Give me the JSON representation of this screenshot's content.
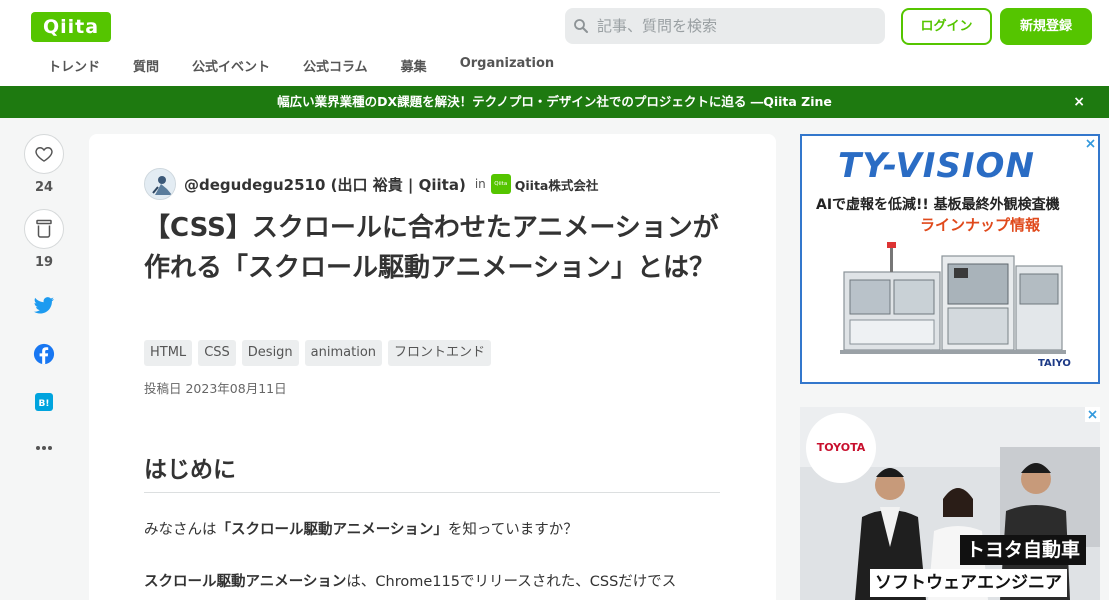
{
  "header": {
    "logo_text": "Qiita",
    "search_placeholder": "記事、質問を検索",
    "login_label": "ログイン",
    "signup_label": "新規登録",
    "nav": [
      "トレンド",
      "質問",
      "公式イベント",
      "公式コラム",
      "募集",
      "Organization"
    ]
  },
  "banner": {
    "text": "幅広い業界業種のDX課題を解決！テクノプロ・デザイン社でのプロジェクトに迫る ―Qiita Zine",
    "close_glyph": "×"
  },
  "actions": {
    "likes_count": "24",
    "stock_count": "19"
  },
  "article": {
    "author": "@degudegu2510 (出口 裕貴 | Qiita)",
    "in_label": "in",
    "org_logo_text": "Qiita",
    "organization": "Qiita株式会社",
    "title": "【CSS】スクロールに合わせたアニメーションが作れる「スクロール駆動アニメーション」とは？",
    "tags": [
      "HTML",
      "CSS",
      "Design",
      "animation",
      "フロントエンド"
    ],
    "posted_date": "投稿日 2023年08月11日",
    "heading": "はじめに",
    "para1_pre": "みなさんは",
    "para1_bold": "「スクロール駆動アニメーション」",
    "para1_post": "を知っていますか？",
    "para2_bold": "スクロール駆動アニメーション",
    "para2_post": "は、Chrome115でリリースされた、CSSだけでス"
  },
  "ads": {
    "ad1": {
      "brand": "TY-VISION",
      "tagline1": "AIで虚報を低減!! 基板最終外観検査機",
      "tagline2": "ラインナップ情報",
      "maker": "TAIYO"
    },
    "ad2": {
      "logo_text": "TOYOTA",
      "caption1": "トヨタ自動車",
      "caption2": "ソフトウェアエンジニア"
    }
  },
  "colors": {
    "brand_green": "#55c500",
    "banner_green": "#1e7a10",
    "twitter_blue": "#1d9bf0",
    "facebook_blue": "#1877f2",
    "hatena_blue": "#00a4de"
  }
}
